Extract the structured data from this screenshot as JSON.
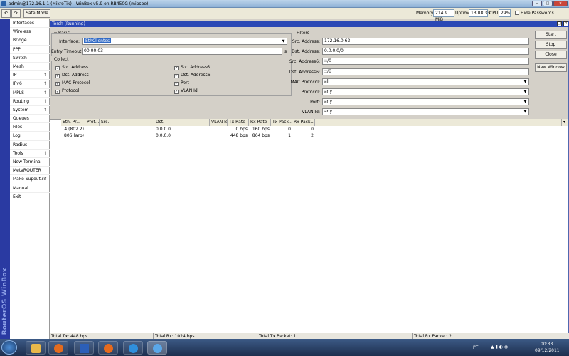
{
  "window": {
    "title": "admin@172.16.1.1 (MikroTik) - WinBox v5.9 on RB450G (mipsbe)"
  },
  "toolbar": {
    "undo": "↶",
    "redo": "↷",
    "safe_mode": "Safe Mode",
    "memory_label": "Memory:",
    "memory_value": "214.9 MiB",
    "uptime_label": "Uptime:",
    "uptime_value": "13:08:33",
    "cpu_label": "CPU:",
    "cpu_value": "29%",
    "hide_passwords": "Hide Passwords"
  },
  "sidebar": {
    "brand": "RouterOS WinBox",
    "items": [
      {
        "label": "Interfaces",
        "arrow": ""
      },
      {
        "label": "Wireless",
        "arrow": ""
      },
      {
        "label": "Bridge",
        "arrow": ""
      },
      {
        "label": "PPP",
        "arrow": ""
      },
      {
        "label": "Switch",
        "arrow": ""
      },
      {
        "label": "Mesh",
        "arrow": ""
      },
      {
        "label": "IP",
        "arrow": "↑"
      },
      {
        "label": "IPv6",
        "arrow": "↑"
      },
      {
        "label": "MPLS",
        "arrow": "↑"
      },
      {
        "label": "Routing",
        "arrow": "↑"
      },
      {
        "label": "System",
        "arrow": "↑"
      },
      {
        "label": "Queues",
        "arrow": ""
      },
      {
        "label": "Files",
        "arrow": ""
      },
      {
        "label": "Log",
        "arrow": ""
      },
      {
        "label": "Radius",
        "arrow": ""
      },
      {
        "label": "Tools",
        "arrow": "↑"
      },
      {
        "label": "New Terminal",
        "arrow": ""
      },
      {
        "label": "MetaROUTER",
        "arrow": ""
      },
      {
        "label": "Make Supout.rif",
        "arrow": ""
      },
      {
        "label": "Manual",
        "arrow": ""
      },
      {
        "label": "Exit",
        "arrow": ""
      }
    ]
  },
  "torch": {
    "title": "Torch (Running)",
    "basic": {
      "group": "Basic",
      "interface_label": "Interface:",
      "interface_value": "EthClientes",
      "timeout_label": "Entry Timeout:",
      "timeout_value": "00:00:03",
      "timeout_unit": "s"
    },
    "collect": {
      "group": "Collect",
      "items": [
        "Src. Address",
        "Src. Address6",
        "Dst. Address",
        "Dst. Address6",
        "MAC Protocol",
        "Port",
        "Protocol",
        "VLAN Id"
      ]
    },
    "filters": {
      "group": "Filters",
      "fields": [
        {
          "label": "Src. Address:",
          "value": "172.16.0.63"
        },
        {
          "label": "Dst. Address:",
          "value": "0.0.0.0/0"
        },
        {
          "label": "Src. Address6:",
          "value": "::/0"
        },
        {
          "label": "Dst. Address6:",
          "value": "::/0"
        },
        {
          "label": "MAC Protocol:",
          "value": "all"
        },
        {
          "label": "Protocol:",
          "value": "any"
        },
        {
          "label": "Port:",
          "value": "any"
        },
        {
          "label": "VLAN Id:",
          "value": "any"
        }
      ]
    },
    "buttons": {
      "start": "Start",
      "stop": "Stop",
      "close": "Close",
      "new_window": "New Window"
    },
    "table": {
      "columns": [
        "Eth. Pr...",
        "Prot...",
        "Src.",
        "Dst.",
        "VLAN Id",
        "Tx Rate",
        "Rx Rate",
        "Tx Pack...",
        "Rx Pack..."
      ],
      "rows": [
        [
          "4 (802.2)",
          "",
          "",
          "0.0.0.0",
          "",
          "0 bps",
          "160 bps",
          "0",
          "0"
        ],
        [
          "806 (arp)",
          "",
          "",
          "0.0.0.0",
          "",
          "448 bps",
          "864 bps",
          "1",
          "2"
        ]
      ]
    },
    "status": {
      "total_tx": "Total Tx: 448 bps",
      "total_rx": "Total Rx: 1024 bps",
      "total_tx_packet": "Total Tx Packet: 1",
      "total_rx_packet": "Total Rx Packet: 2"
    }
  },
  "taskbar": {
    "lang": "PT",
    "time": "00:33",
    "date": "09/12/2011"
  },
  "colors": {
    "accent": "#2a48b5",
    "sidebar_strip": "#2a3aa2",
    "selection": "#316ac5"
  }
}
